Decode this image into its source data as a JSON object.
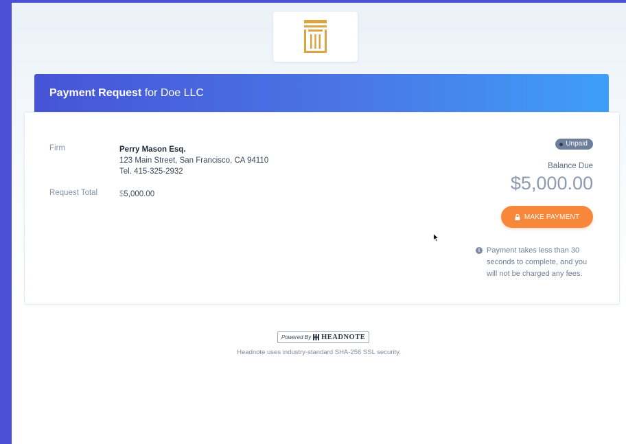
{
  "header": {
    "logo_icon": "pillar-icon",
    "brand_color": "#d9a441"
  },
  "banner": {
    "title_bold": "Payment Request",
    "title_rest": " for Doe LLC"
  },
  "details": {
    "firm_label": "Firm",
    "firm_name": "Perry Mason Esq.",
    "firm_address": "123 Main Street, San Francisco, CA 94110",
    "firm_phone": "Tel. 415-325-2932",
    "total_label": "Request Total",
    "total_currency": "$",
    "total_value": "5,000.00"
  },
  "summary": {
    "status_badge": "Unpaid",
    "balance_label": "Balance Due",
    "balance_currency": "$",
    "balance_value": "5,000.00",
    "pay_button": "MAKE PAYMENT",
    "info_text": "Payment takes less than 30 seconds to complete, and you will not be charged any fees."
  },
  "footer": {
    "powered_by": "Powered By",
    "brand": "HEADNOTE",
    "security_text": "Headnote uses industry-standard SHA-256 SSL security."
  },
  "colors": {
    "banner_start": "#4654d6",
    "banner_end": "#3e9ff7",
    "pay_button": "#f7873a",
    "badge": "#6d7f9a"
  }
}
